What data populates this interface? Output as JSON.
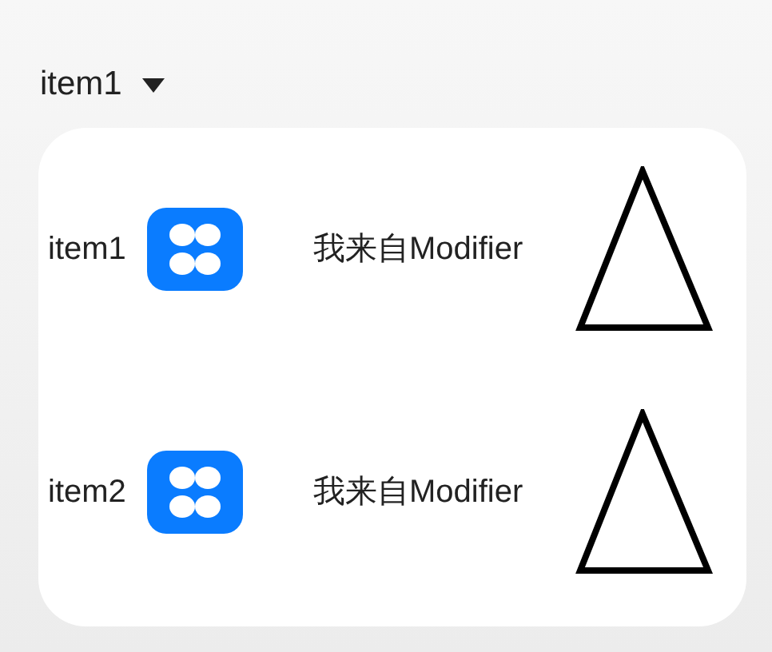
{
  "dropdown": {
    "label": "item1"
  },
  "items": [
    {
      "label": "item1",
      "text": "我来自Modifier"
    },
    {
      "label": "item2",
      "text": "我来自Modifier"
    }
  ]
}
